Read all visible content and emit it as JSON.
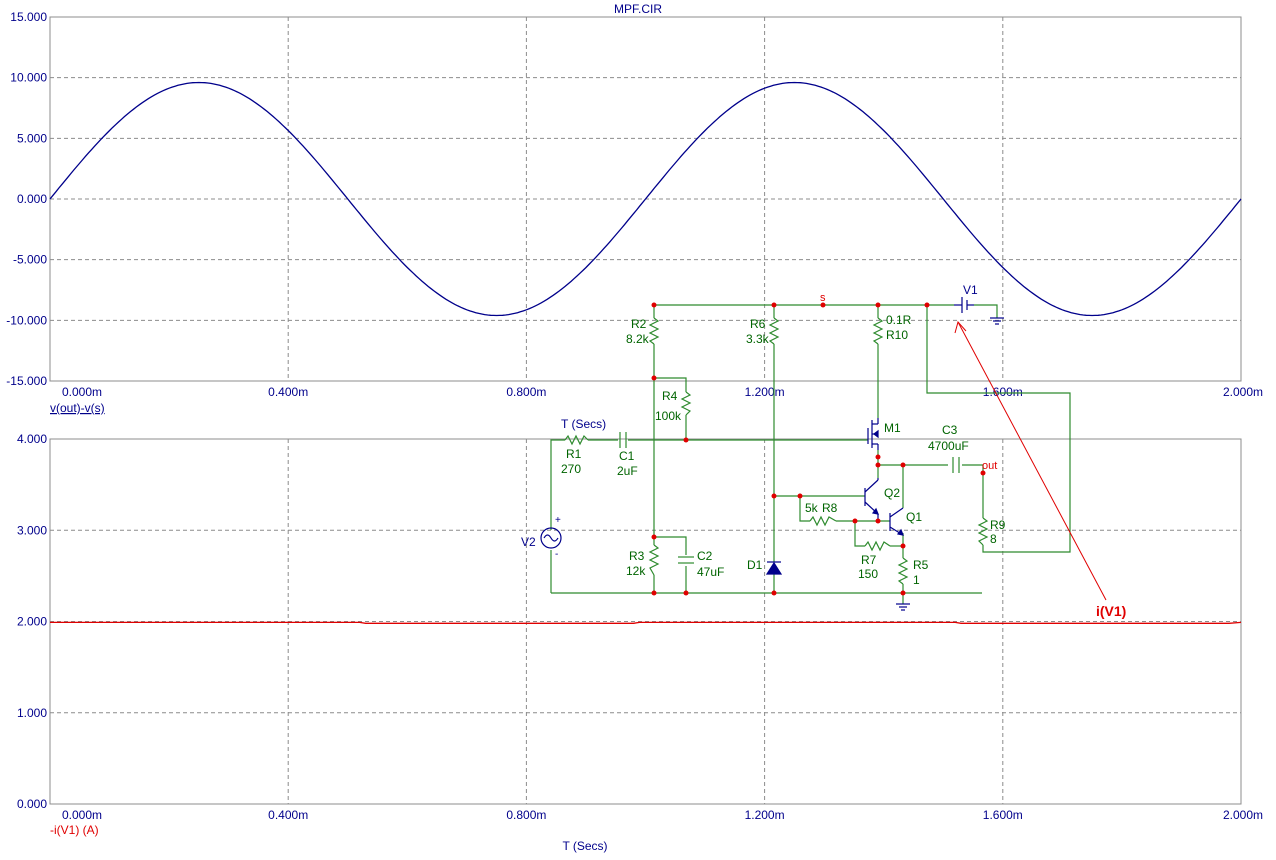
{
  "window_title": "MPF.CIR",
  "chart_data": [
    {
      "type": "line",
      "xlabel": "",
      "ylabel": "v(out)-v(s)",
      "x_ticks": [
        "0.000m",
        "0.400m",
        "0.800m",
        "1.200m",
        "1.600m",
        "2.000m"
      ],
      "y_ticks": [
        "15.000",
        "10.000",
        "5.000",
        "0.000",
        "-5.000",
        "-10.000",
        "-15.000"
      ],
      "xlim": [
        0,
        2.0
      ],
      "ylim": [
        -15,
        15
      ],
      "grid": true,
      "series": [
        {
          "name": "v(out)-v(s)",
          "color": "#00008b",
          "x": [
            0.0,
            0.05,
            0.1,
            0.15,
            0.2,
            0.25,
            0.3,
            0.35,
            0.4,
            0.45,
            0.5,
            0.55,
            0.6,
            0.65,
            0.7,
            0.75,
            0.8,
            0.85,
            0.9,
            0.95,
            1.0,
            1.05,
            1.1,
            1.15,
            1.2,
            1.25,
            1.3,
            1.35,
            1.4,
            1.45,
            1.5,
            1.55,
            1.6,
            1.65,
            1.7,
            1.75,
            1.8,
            1.85,
            1.9,
            1.95,
            2.0
          ],
          "y": [
            0.0,
            2.97,
            5.64,
            7.77,
            9.13,
            9.6,
            9.13,
            7.77,
            5.64,
            2.97,
            0.0,
            -2.97,
            -5.64,
            -7.77,
            -9.13,
            -9.6,
            -9.13,
            -7.77,
            -5.64,
            -2.97,
            0.0,
            2.97,
            5.64,
            7.77,
            9.13,
            9.6,
            9.13,
            7.77,
            5.64,
            2.97,
            0.0,
            -2.97,
            -5.64,
            -7.77,
            -9.13,
            -9.6,
            -9.13,
            -7.77,
            -5.64,
            -2.97,
            0.0
          ]
        }
      ]
    },
    {
      "type": "line",
      "xlabel": "T (Secs)",
      "ylabel": "-i(V1) (A)",
      "x_ticks": [
        "0.000m",
        "0.400m",
        "0.800m",
        "1.200m",
        "1.600m",
        "2.000m"
      ],
      "y_ticks": [
        "4.000",
        "3.000",
        "2.000",
        "1.000",
        "0.000"
      ],
      "xlim": [
        0,
        2.0
      ],
      "ylim": [
        0,
        4
      ],
      "grid": true,
      "series": [
        {
          "name": "-i(V1) (A)",
          "color": "#e00000",
          "x": [
            0.0,
            0.52,
            0.53,
            0.98,
            0.99,
            1.52,
            1.53,
            1.98,
            2.0
          ],
          "y": [
            1.99,
            1.99,
            1.98,
            1.98,
            1.99,
            1.99,
            1.98,
            1.98,
            1.99
          ]
        }
      ]
    }
  ],
  "schematic": {
    "sweep_label": "T (Secs)",
    "probe_label": "i(V1)",
    "components": {
      "r1": {
        "name": "R1",
        "value": "270"
      },
      "c1": {
        "name": "C1",
        "value": "2uF"
      },
      "r2": {
        "name": "R2",
        "value": "8.2k"
      },
      "r3": {
        "name": "R3",
        "value": "12k"
      },
      "r4": {
        "name": "R4",
        "value": "100k"
      },
      "c2": {
        "name": "C2",
        "value": "47uF"
      },
      "r6": {
        "name": "R6",
        "value": "3.3k"
      },
      "d1": {
        "name": "D1"
      },
      "r10": {
        "name": "R10",
        "value": "0.1R"
      },
      "m1": {
        "name": "M1"
      },
      "q1": {
        "name": "Q1"
      },
      "q2": {
        "name": "Q2"
      },
      "r8": {
        "name": "R8",
        "value": "5k"
      },
      "r7": {
        "name": "R7",
        "value": "150"
      },
      "r5": {
        "name": "R5",
        "value": "1"
      },
      "c3": {
        "name": "C3",
        "value": "4700uF"
      },
      "r9": {
        "name": "R9",
        "value": "8"
      },
      "v1": {
        "name": "V1"
      },
      "v2": {
        "name": "V2",
        "plus": "+",
        "minus": "-"
      }
    },
    "nodes": {
      "s": "s",
      "out": "out"
    }
  }
}
